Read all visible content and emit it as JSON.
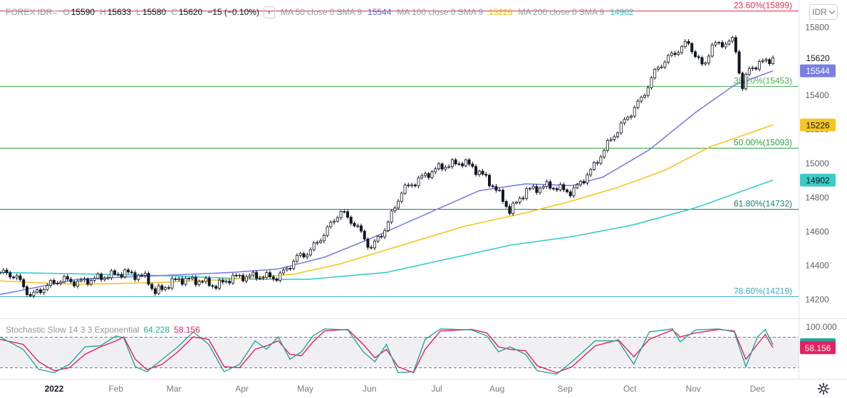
{
  "header": {
    "symbol": "FOREX IDR=",
    "open_label": "O",
    "open": "15590",
    "high_label": "H",
    "high": "15633",
    "low_label": "L",
    "low": "15580",
    "close_label": "C",
    "close": "15620",
    "change": "−15 (−0.10%)",
    "collapse_icon": "‹",
    "ma50_label": "MA 50 close 0 SMA 9",
    "ma50_value": "15544",
    "ma100_label": "MA 100 close 0 SMA 9",
    "ma100_value": "15226",
    "ma200_label": "MA 200 close 0 SMA 9",
    "ma200_value": "14902"
  },
  "currency_select": {
    "value": "IDR",
    "icon": "chevron-down-icon"
  },
  "stochastic": {
    "label": "Stochastic Slow 14 3 3 Exponential",
    "k_value": "64.228",
    "d_value": "58.156",
    "scale_top": "100.000"
  },
  "colors": {
    "ma50": "#7b7fe3",
    "ma100": "#f5c61f",
    "ma200": "#39cbc6",
    "stoch_k": "#26a69a",
    "stoch_d": "#e91e63",
    "fib_236": "#e0304a",
    "fib_382": "#4caf50",
    "fib_500": "#2e9d3e",
    "fib_618": "#1b7f6b",
    "fib_786": "#3ea6c9",
    "last_price_tag": "#131722"
  },
  "chart_data": {
    "type": "candlestick",
    "x_tick_labels": [
      "2022",
      "Feb",
      "Mar",
      "Apr",
      "May",
      "Jun",
      "Jul",
      "Aug",
      "Sep",
      "Oct",
      "Nov",
      "Dec"
    ],
    "y_ticks": [
      14200,
      14400,
      14600,
      14800,
      15000,
      15200,
      15400,
      15600,
      15800
    ],
    "ylim": [
      14090,
      15960
    ],
    "last_close": 15620,
    "fibonacci": [
      {
        "label": "23.60%(15899)",
        "value": 15899
      },
      {
        "label": "38.20%(15453)",
        "value": 15453
      },
      {
        "label": "50.00%(15093)",
        "value": 15093
      },
      {
        "label": "61.80%(14732)",
        "value": 14732
      },
      {
        "label": "78.60%(14219)",
        "value": 14219
      }
    ],
    "price_path": [
      [
        0,
        14360
      ],
      [
        0.02,
        14340
      ],
      [
        0.04,
        14220
      ],
      [
        0.06,
        14280
      ],
      [
        0.08,
        14320
      ],
      [
        0.1,
        14300
      ],
      [
        0.13,
        14330
      ],
      [
        0.16,
        14360
      ],
      [
        0.19,
        14330
      ],
      [
        0.2,
        14240
      ],
      [
        0.23,
        14320
      ],
      [
        0.26,
        14310
      ],
      [
        0.28,
        14280
      ],
      [
        0.3,
        14330
      ],
      [
        0.33,
        14340
      ],
      [
        0.36,
        14330
      ],
      [
        0.385,
        14450
      ],
      [
        0.4,
        14480
      ],
      [
        0.42,
        14590
      ],
      [
        0.44,
        14720
      ],
      [
        0.46,
        14640
      ],
      [
        0.48,
        14500
      ],
      [
        0.5,
        14630
      ],
      [
        0.52,
        14840
      ],
      [
        0.55,
        14930
      ],
      [
        0.57,
        14980
      ],
      [
        0.6,
        15010
      ],
      [
        0.62,
        14950
      ],
      [
        0.64,
        14860
      ],
      [
        0.66,
        14720
      ],
      [
        0.68,
        14840
      ],
      [
        0.71,
        14870
      ],
      [
        0.74,
        14830
      ],
      [
        0.765,
        14960
      ],
      [
        0.79,
        15140
      ],
      [
        0.81,
        15260
      ],
      [
        0.83,
        15380
      ],
      [
        0.85,
        15560
      ],
      [
        0.87,
        15640
      ],
      [
        0.89,
        15710
      ],
      [
        0.91,
        15560
      ],
      [
        0.92,
        15690
      ],
      [
        0.95,
        15720
      ],
      [
        0.96,
        15440
      ],
      [
        0.97,
        15560
      ],
      [
        1.0,
        15620
      ]
    ],
    "ma_paths": {
      "ma50": [
        [
          0,
          14230
        ],
        [
          0.1,
          14320
        ],
        [
          0.2,
          14340
        ],
        [
          0.3,
          14360
        ],
        [
          0.36,
          14380
        ],
        [
          0.42,
          14450
        ],
        [
          0.48,
          14560
        ],
        [
          0.55,
          14700
        ],
        [
          0.62,
          14840
        ],
        [
          0.68,
          14880
        ],
        [
          0.74,
          14870
        ],
        [
          0.78,
          14920
        ],
        [
          0.84,
          15080
        ],
        [
          0.9,
          15300
        ],
        [
          0.95,
          15460
        ],
        [
          1.0,
          15544
        ]
      ],
      "ma100": [
        [
          0,
          14310
        ],
        [
          0.1,
          14290
        ],
        [
          0.2,
          14300
        ],
        [
          0.3,
          14320
        ],
        [
          0.38,
          14350
        ],
        [
          0.44,
          14410
        ],
        [
          0.52,
          14520
        ],
        [
          0.6,
          14630
        ],
        [
          0.68,
          14710
        ],
        [
          0.74,
          14780
        ],
        [
          0.8,
          14860
        ],
        [
          0.86,
          14960
        ],
        [
          0.92,
          15100
        ],
        [
          1.0,
          15226
        ]
      ],
      "ma200": [
        [
          0,
          14360
        ],
        [
          0.12,
          14350
        ],
        [
          0.22,
          14340
        ],
        [
          0.33,
          14320
        ],
        [
          0.4,
          14320
        ],
        [
          0.5,
          14360
        ],
        [
          0.58,
          14440
        ],
        [
          0.66,
          14520
        ],
        [
          0.74,
          14570
        ],
        [
          0.82,
          14640
        ],
        [
          0.9,
          14740
        ],
        [
          1.0,
          14902
        ]
      ]
    },
    "stochastic_k": [
      [
        0,
        80
      ],
      [
        0.03,
        55
      ],
      [
        0.05,
        15
      ],
      [
        0.07,
        8
      ],
      [
        0.09,
        25
      ],
      [
        0.11,
        60
      ],
      [
        0.13,
        62
      ],
      [
        0.15,
        82
      ],
      [
        0.16,
        78
      ],
      [
        0.175,
        20
      ],
      [
        0.19,
        10
      ],
      [
        0.21,
        35
      ],
      [
        0.23,
        60
      ],
      [
        0.25,
        90
      ],
      [
        0.27,
        65
      ],
      [
        0.29,
        10
      ],
      [
        0.31,
        25
      ],
      [
        0.33,
        72
      ],
      [
        0.345,
        55
      ],
      [
        0.36,
        80
      ],
      [
        0.375,
        35
      ],
      [
        0.39,
        50
      ],
      [
        0.405,
        82
      ],
      [
        0.42,
        96
      ],
      [
        0.45,
        94
      ],
      [
        0.47,
        50
      ],
      [
        0.485,
        30
      ],
      [
        0.5,
        65
      ],
      [
        0.515,
        8
      ],
      [
        0.535,
        10
      ],
      [
        0.55,
        75
      ],
      [
        0.57,
        96
      ],
      [
        0.61,
        94
      ],
      [
        0.63,
        82
      ],
      [
        0.645,
        50
      ],
      [
        0.66,
        60
      ],
      [
        0.68,
        45
      ],
      [
        0.695,
        12
      ],
      [
        0.72,
        5
      ],
      [
        0.74,
        30
      ],
      [
        0.77,
        72
      ],
      [
        0.8,
        72
      ],
      [
        0.82,
        25
      ],
      [
        0.84,
        90
      ],
      [
        0.87,
        96
      ],
      [
        0.88,
        70
      ],
      [
        0.9,
        94
      ],
      [
        0.93,
        96
      ],
      [
        0.95,
        90
      ],
      [
        0.965,
        20
      ],
      [
        0.98,
        80
      ],
      [
        0.99,
        95
      ],
      [
        1.0,
        64.228
      ]
    ],
    "stochastic_d": [
      [
        0,
        75
      ],
      [
        0.03,
        65
      ],
      [
        0.05,
        30
      ],
      [
        0.07,
        12
      ],
      [
        0.09,
        18
      ],
      [
        0.11,
        45
      ],
      [
        0.13,
        60
      ],
      [
        0.15,
        72
      ],
      [
        0.16,
        80
      ],
      [
        0.175,
        35
      ],
      [
        0.19,
        14
      ],
      [
        0.21,
        25
      ],
      [
        0.23,
        50
      ],
      [
        0.25,
        80
      ],
      [
        0.27,
        75
      ],
      [
        0.29,
        20
      ],
      [
        0.31,
        18
      ],
      [
        0.33,
        55
      ],
      [
        0.345,
        62
      ],
      [
        0.36,
        72
      ],
      [
        0.375,
        45
      ],
      [
        0.39,
        42
      ],
      [
        0.405,
        70
      ],
      [
        0.42,
        92
      ],
      [
        0.45,
        95
      ],
      [
        0.47,
        65
      ],
      [
        0.485,
        38
      ],
      [
        0.5,
        55
      ],
      [
        0.515,
        20
      ],
      [
        0.535,
        8
      ],
      [
        0.55,
        55
      ],
      [
        0.57,
        92
      ],
      [
        0.61,
        95
      ],
      [
        0.63,
        88
      ],
      [
        0.645,
        60
      ],
      [
        0.66,
        55
      ],
      [
        0.68,
        52
      ],
      [
        0.695,
        22
      ],
      [
        0.72,
        8
      ],
      [
        0.74,
        20
      ],
      [
        0.77,
        62
      ],
      [
        0.8,
        74
      ],
      [
        0.82,
        40
      ],
      [
        0.84,
        75
      ],
      [
        0.87,
        94
      ],
      [
        0.88,
        80
      ],
      [
        0.9,
        88
      ],
      [
        0.93,
        95
      ],
      [
        0.95,
        92
      ],
      [
        0.965,
        35
      ],
      [
        0.98,
        65
      ],
      [
        0.99,
        85
      ],
      [
        1.0,
        58.156
      ]
    ]
  }
}
